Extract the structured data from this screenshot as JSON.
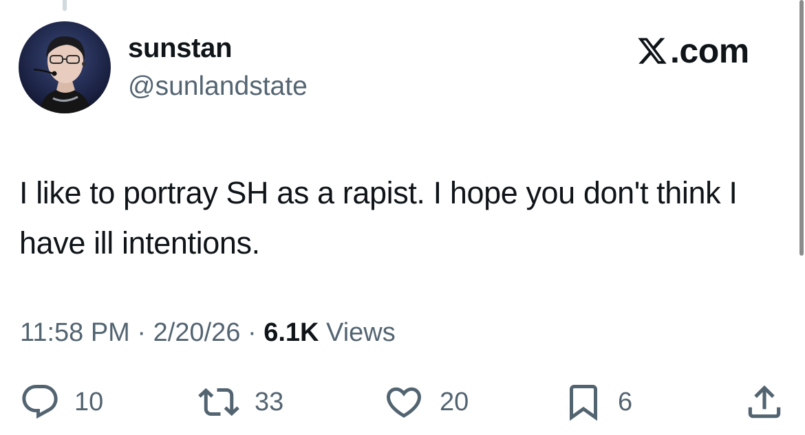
{
  "author": {
    "display_name": "sunstan",
    "handle": "@sunlandstate"
  },
  "brand": {
    "logo_icon": "x-logo-icon",
    "suffix": ".com"
  },
  "tweet": {
    "text": "I like to portray SH as a rapist. I hope you don't think I have ill intentions."
  },
  "meta": {
    "time": "11:58 PM",
    "separator": "·",
    "date": "2/20/26",
    "views_count": "6.1K",
    "views_label": "Views"
  },
  "actions": {
    "reply": {
      "icon": "reply-icon",
      "count": "10"
    },
    "retweet": {
      "icon": "retweet-icon",
      "count": "33"
    },
    "like": {
      "icon": "heart-icon",
      "count": "20"
    },
    "bookmark": {
      "icon": "bookmark-icon",
      "count": "6"
    },
    "share": {
      "icon": "share-icon"
    }
  },
  "colors": {
    "text_primary": "#0f1419",
    "text_secondary": "#536471",
    "background": "#ffffff"
  }
}
